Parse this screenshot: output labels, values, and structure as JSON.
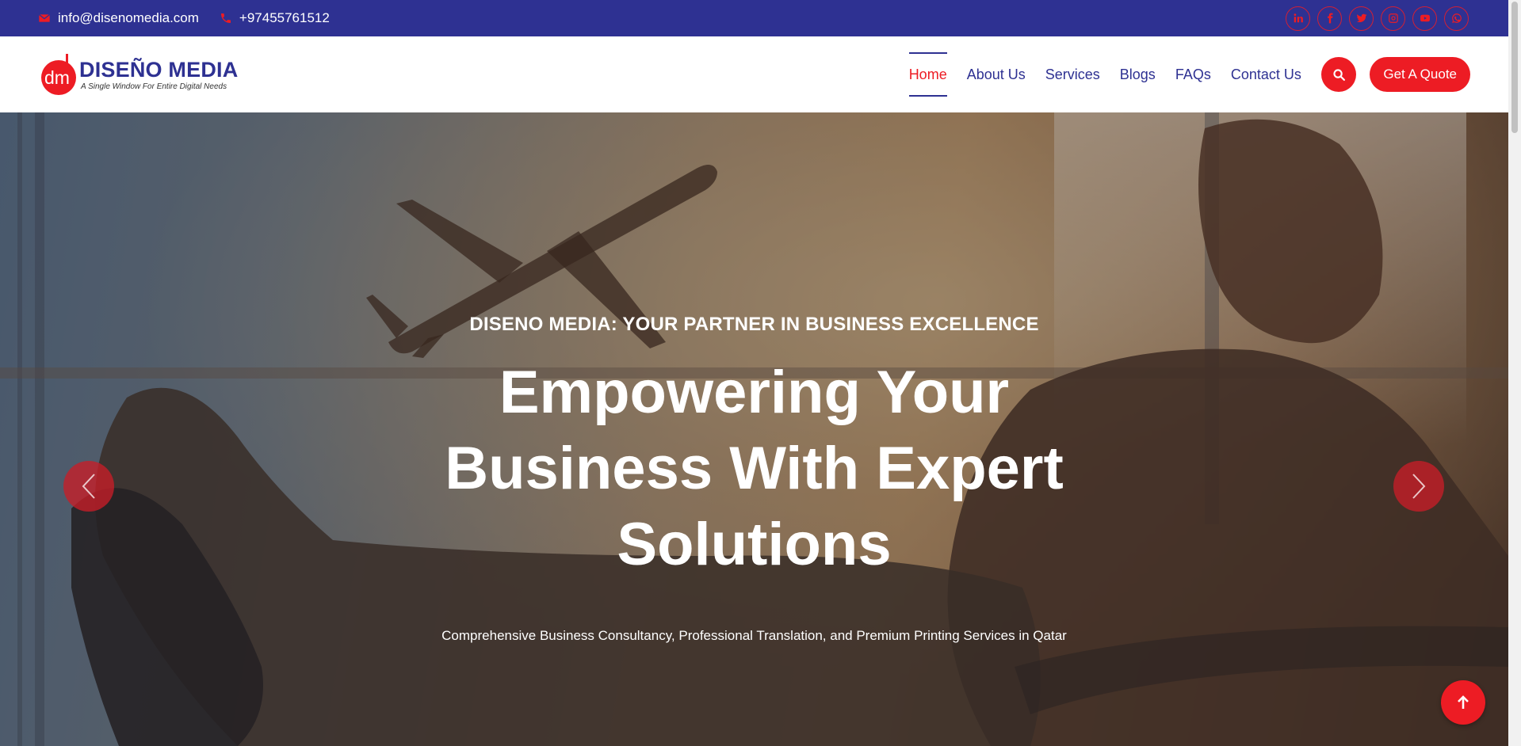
{
  "topbar": {
    "email": "info@disenomedia.com",
    "phone": "+97455761512",
    "socials": [
      "linkedin-icon",
      "facebook-icon",
      "twitter-icon",
      "instagram-icon",
      "youtube-icon",
      "whatsapp-icon"
    ]
  },
  "brand": {
    "mark": "dm",
    "name": "DISEÑO MEDIA",
    "tagline": "A Single Window For Entire Digital Needs"
  },
  "nav": {
    "items": [
      {
        "label": "Home",
        "active": true
      },
      {
        "label": "About Us"
      },
      {
        "label": "Services"
      },
      {
        "label": "Blogs"
      },
      {
        "label": "FAQs"
      },
      {
        "label": "Contact Us"
      }
    ],
    "search_icon": "search-icon",
    "quote_label": "Get A Quote"
  },
  "hero": {
    "kicker": "DISENO MEDIA: YOUR PARTNER IN BUSINESS EXCELLENCE",
    "title": "Empowering Your Business With Expert Solutions",
    "subtitle": "Comprehensive Business Consultancy, Professional Translation, and Premium Printing Services in Qatar"
  },
  "colors": {
    "primary": "#2e3192",
    "accent": "#ed1c24"
  }
}
